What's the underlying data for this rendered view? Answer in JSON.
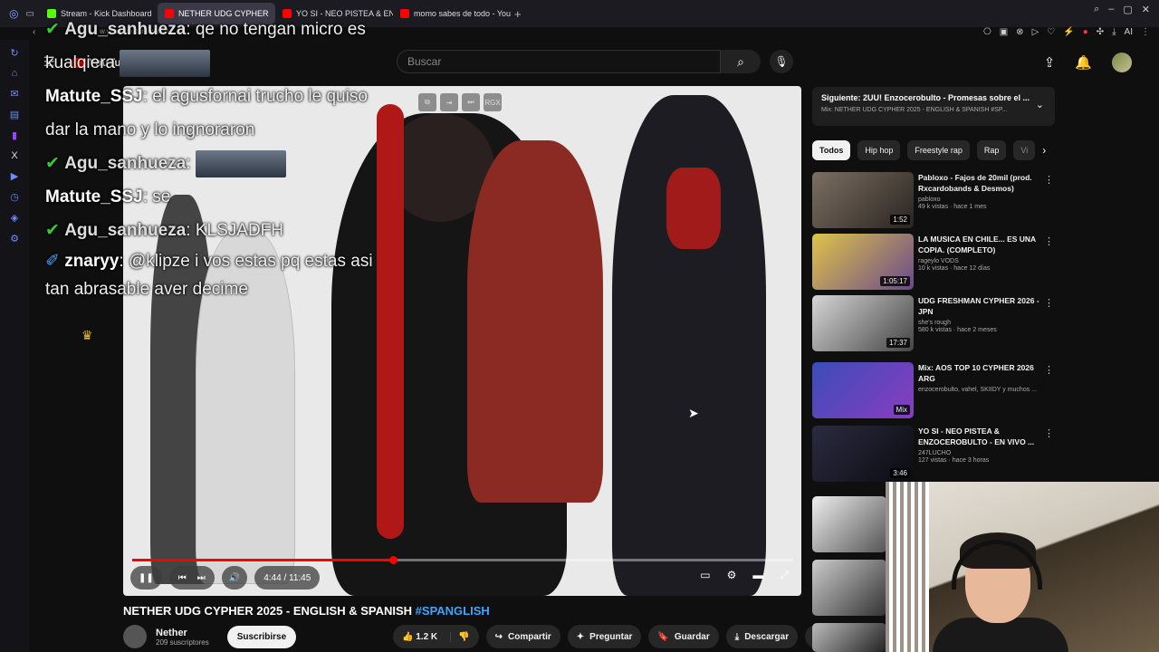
{
  "browser": {
    "tabs": [
      {
        "title": "Stream - Kick Dashboard",
        "color": "#53fc18"
      },
      {
        "title": "NETHER UDG CYPHER",
        "color": "#ff0000"
      },
      {
        "title": "YO SI - NEO PISTEA & EN...",
        "color": "#ff0000"
      },
      {
        "title": "momo sabes de todo - You...",
        "color": "#ff0000"
      }
    ],
    "url": "w.youtube.com/watch"
  },
  "youtube": {
    "logo": "YouTube",
    "search_placeholder": "Buscar"
  },
  "chat": [
    {
      "user": "Agu_sanhueza",
      "text": ": qe no tengan micro es kualqiera",
      "emote": true
    },
    {
      "user": "Matute_SSJ",
      "text": ": el agusfornai trucho le quiso dar la mano y lo ingnoraron",
      "emote": false
    },
    {
      "user": "Agu_sanhueza",
      "text": ":",
      "emote": true
    },
    {
      "user": "Matute_SSJ",
      "text": ": se",
      "emote": false
    },
    {
      "user": "Agu_sanhueza",
      "text": ": KLSJADFH",
      "emote": false
    },
    {
      "user": "znaryy",
      "text": ": @klipze i vos estas pq estas asi tan abrasable aver decime",
      "emote": false
    }
  ],
  "video": {
    "progress": 0.395,
    "time": "4:44 / 11:45",
    "title": "NETHER UDG CYPHER 2025 - ENGLISH & SPANISH",
    "hashtag": "#SPANGLISH",
    "channel": "Nether",
    "subs": "209 suscriptores",
    "subscribe": "Suscribirse",
    "likes": "1.2 K",
    "share": "Compartir",
    "ask": "Preguntar",
    "save": "Guardar",
    "download": "Descargar",
    "top_badge": "RGX"
  },
  "next": {
    "title": "Siguiente: 2UU! Enzocerobulto - Promesas sobre el ...",
    "subtitle": "Mix: NETHER UDG CYPHER 2025 - ENGLISH & SPANISH #SP..."
  },
  "chips": [
    "Todos",
    "Hip hop",
    "Freestyle rap",
    "Rap",
    "Vi"
  ],
  "recs": [
    {
      "title": "Pabloxo - Fajos de 20mil (prod. Rxcardobands & Desmos)",
      "channel": "pabloxo",
      "meta": "49 k vistas · hace 1 mes",
      "dur": "1:52",
      "c1": "#7c6f62",
      "c2": "#2a2420"
    },
    {
      "title": "LA MUSICA EN CHILE... ES UNA COPIA. (COMPLETO)",
      "channel": "rageylo VODS",
      "meta": "10 k vistas · hace 12 días",
      "dur": "1:05:17",
      "c1": "#e0c34a",
      "c2": "#6a4a8a"
    },
    {
      "title": "UDG FRESHMAN CYPHER 2026 - JPN",
      "channel": "she's rough",
      "meta": "580 k vistas · hace 2 meses",
      "dur": "17:37",
      "c1": "#d6d6d6",
      "c2": "#444"
    },
    {
      "title": "Mix: AOS TOP 10 CYPHER 2026 ARG",
      "channel": "enzocerobulto, vahel, SKIIDY y muchos ...",
      "meta": "",
      "dur": "Mix",
      "c1": "#3b4db8",
      "c2": "#8a3cc2"
    },
    {
      "title": "YO SI - NEO PISTEA & ENZOCEROBULTO - EN VIVO ...",
      "channel": "247LUCHO",
      "meta": "127 vistas · hace 3 horas",
      "dur": "3:46",
      "c1": "#2b2b40",
      "c2": "#0b0b12"
    }
  ]
}
